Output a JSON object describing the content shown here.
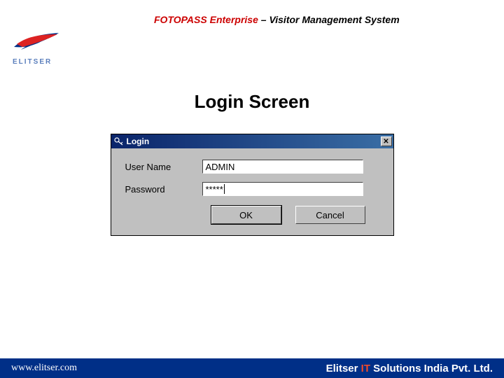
{
  "header": {
    "product": "FOTOPASS Enterprise",
    "separator": " – ",
    "subtitle": "Visitor Management System",
    "logo_text": "ELITSER"
  },
  "main": {
    "title": "Login Screen"
  },
  "dialog": {
    "titlebar_text": "Login",
    "close_symbol": "✕",
    "username_label": "User Name",
    "username_value": "ADMIN",
    "password_label": "Password",
    "password_value": "*****",
    "ok_label": "OK",
    "cancel_label": "Cancel"
  },
  "footer": {
    "left": "www.elitser.com",
    "right_elitser": "Elitser ",
    "right_it": "IT",
    "right_rest": " Solutions India Pvt. Ltd."
  },
  "colors": {
    "brand_red": "#c00",
    "footer_blue": "#002f87"
  }
}
